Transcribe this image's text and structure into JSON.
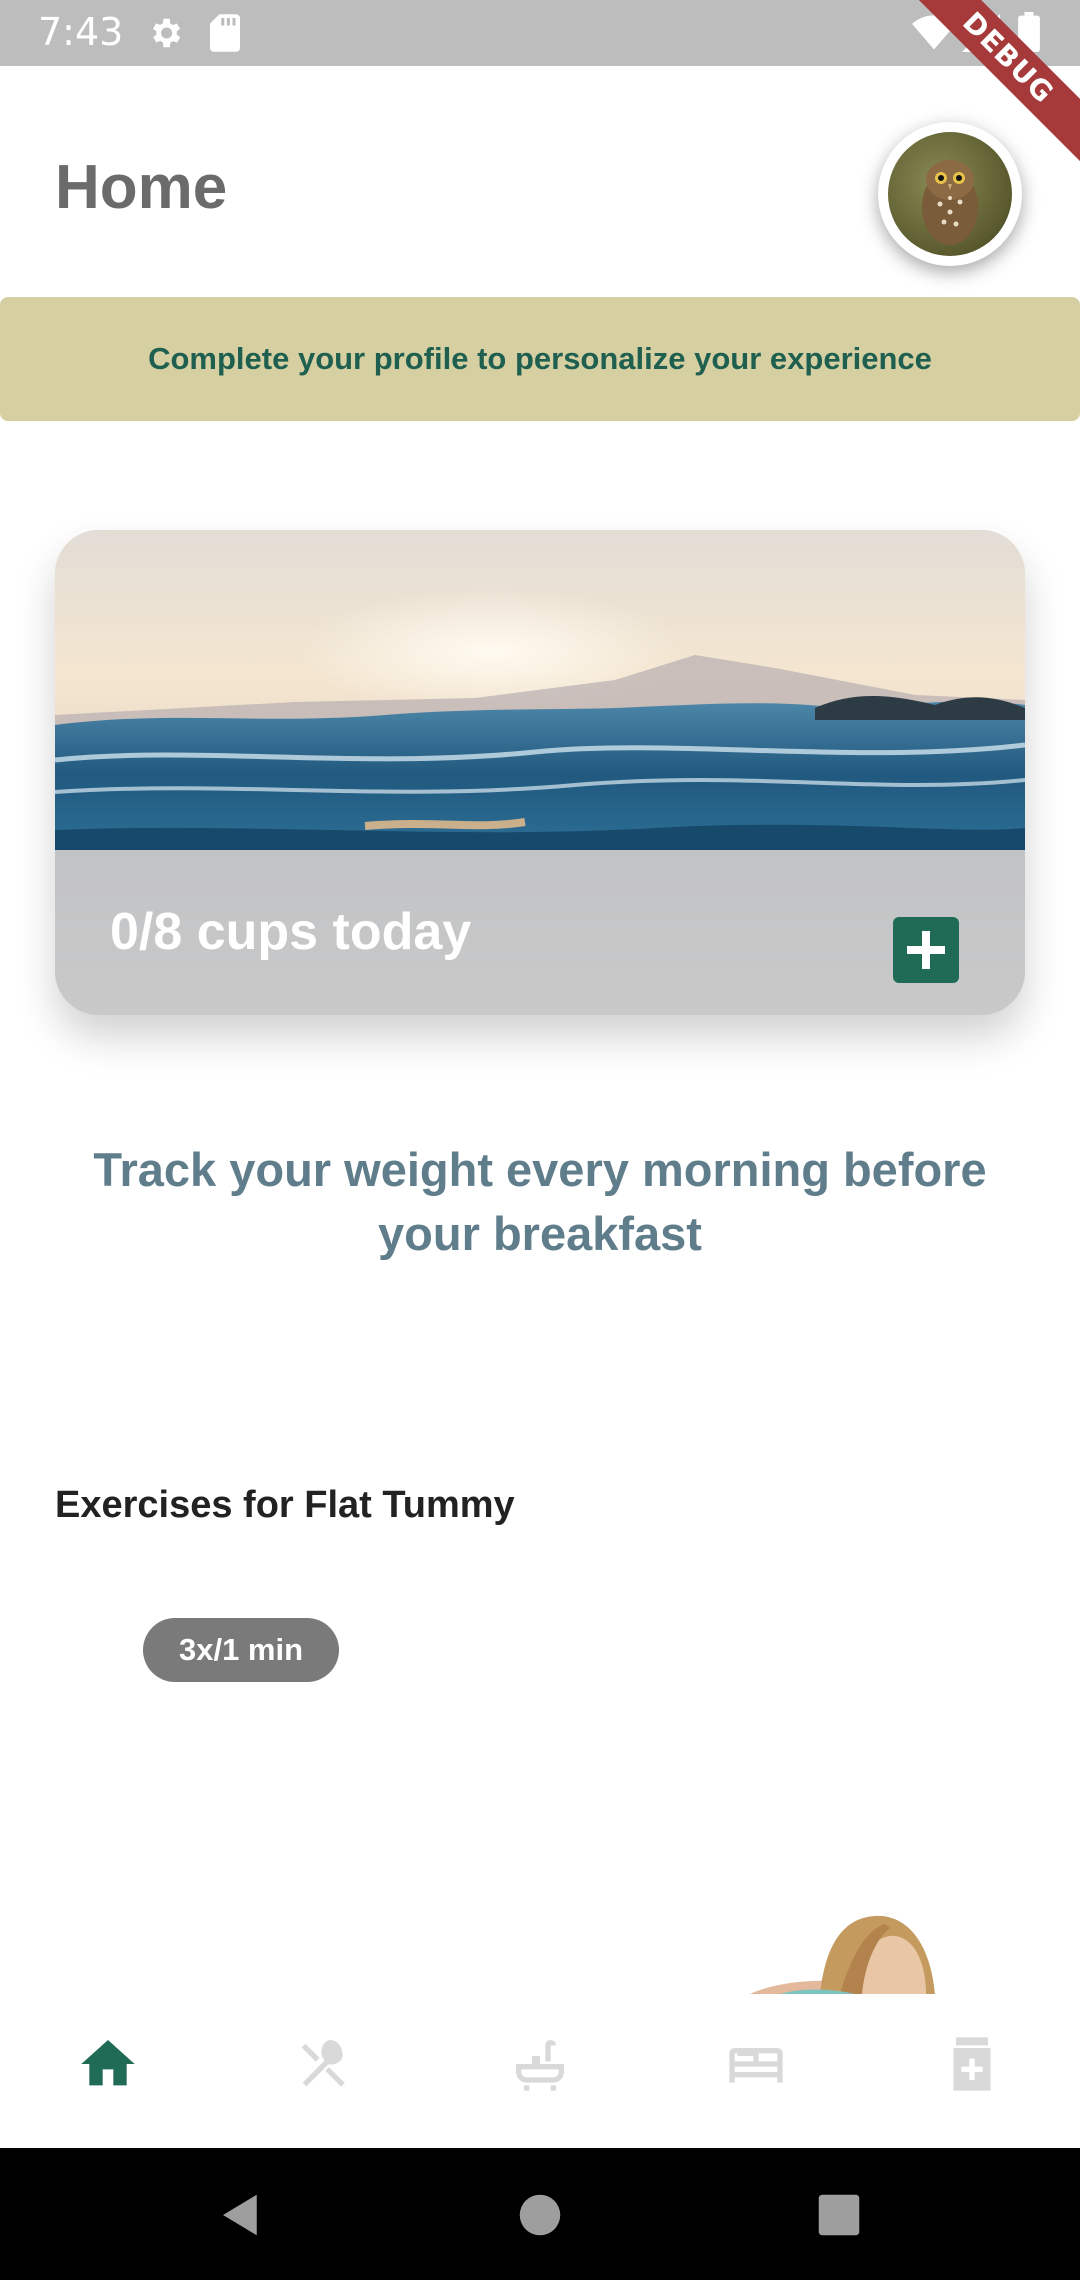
{
  "status_bar": {
    "time": "7:43",
    "icons": [
      "gear-icon",
      "sd-card-icon",
      "wifi-icon",
      "signal-icon",
      "battery-icon"
    ],
    "debug_label": "DEBUG"
  },
  "header": {
    "title": "Home",
    "avatar": "owl-avatar"
  },
  "profile_banner": {
    "text": "Complete your profile to personalize your experience"
  },
  "water_card": {
    "cups_text": "0/8 cups today",
    "add_icon": "plus-icon"
  },
  "weight_tip": {
    "text": "Track your weight every morning before your breakfast"
  },
  "exercises": {
    "title": "Exercises for Flat Tummy",
    "duration": "3x/1 min"
  },
  "bottom_nav": {
    "items": [
      {
        "icon": "home-icon",
        "active": true
      },
      {
        "icon": "restaurant-icon",
        "active": false
      },
      {
        "icon": "bathtub-icon",
        "active": false
      },
      {
        "icon": "bed-icon",
        "active": false
      },
      {
        "icon": "medication-icon",
        "active": false
      }
    ]
  },
  "colors": {
    "accent": "#1f6b55",
    "banner_bg": "#d6cfa2",
    "tip_text": "#607d8b",
    "nav_inactive": "#d9d9d9"
  }
}
